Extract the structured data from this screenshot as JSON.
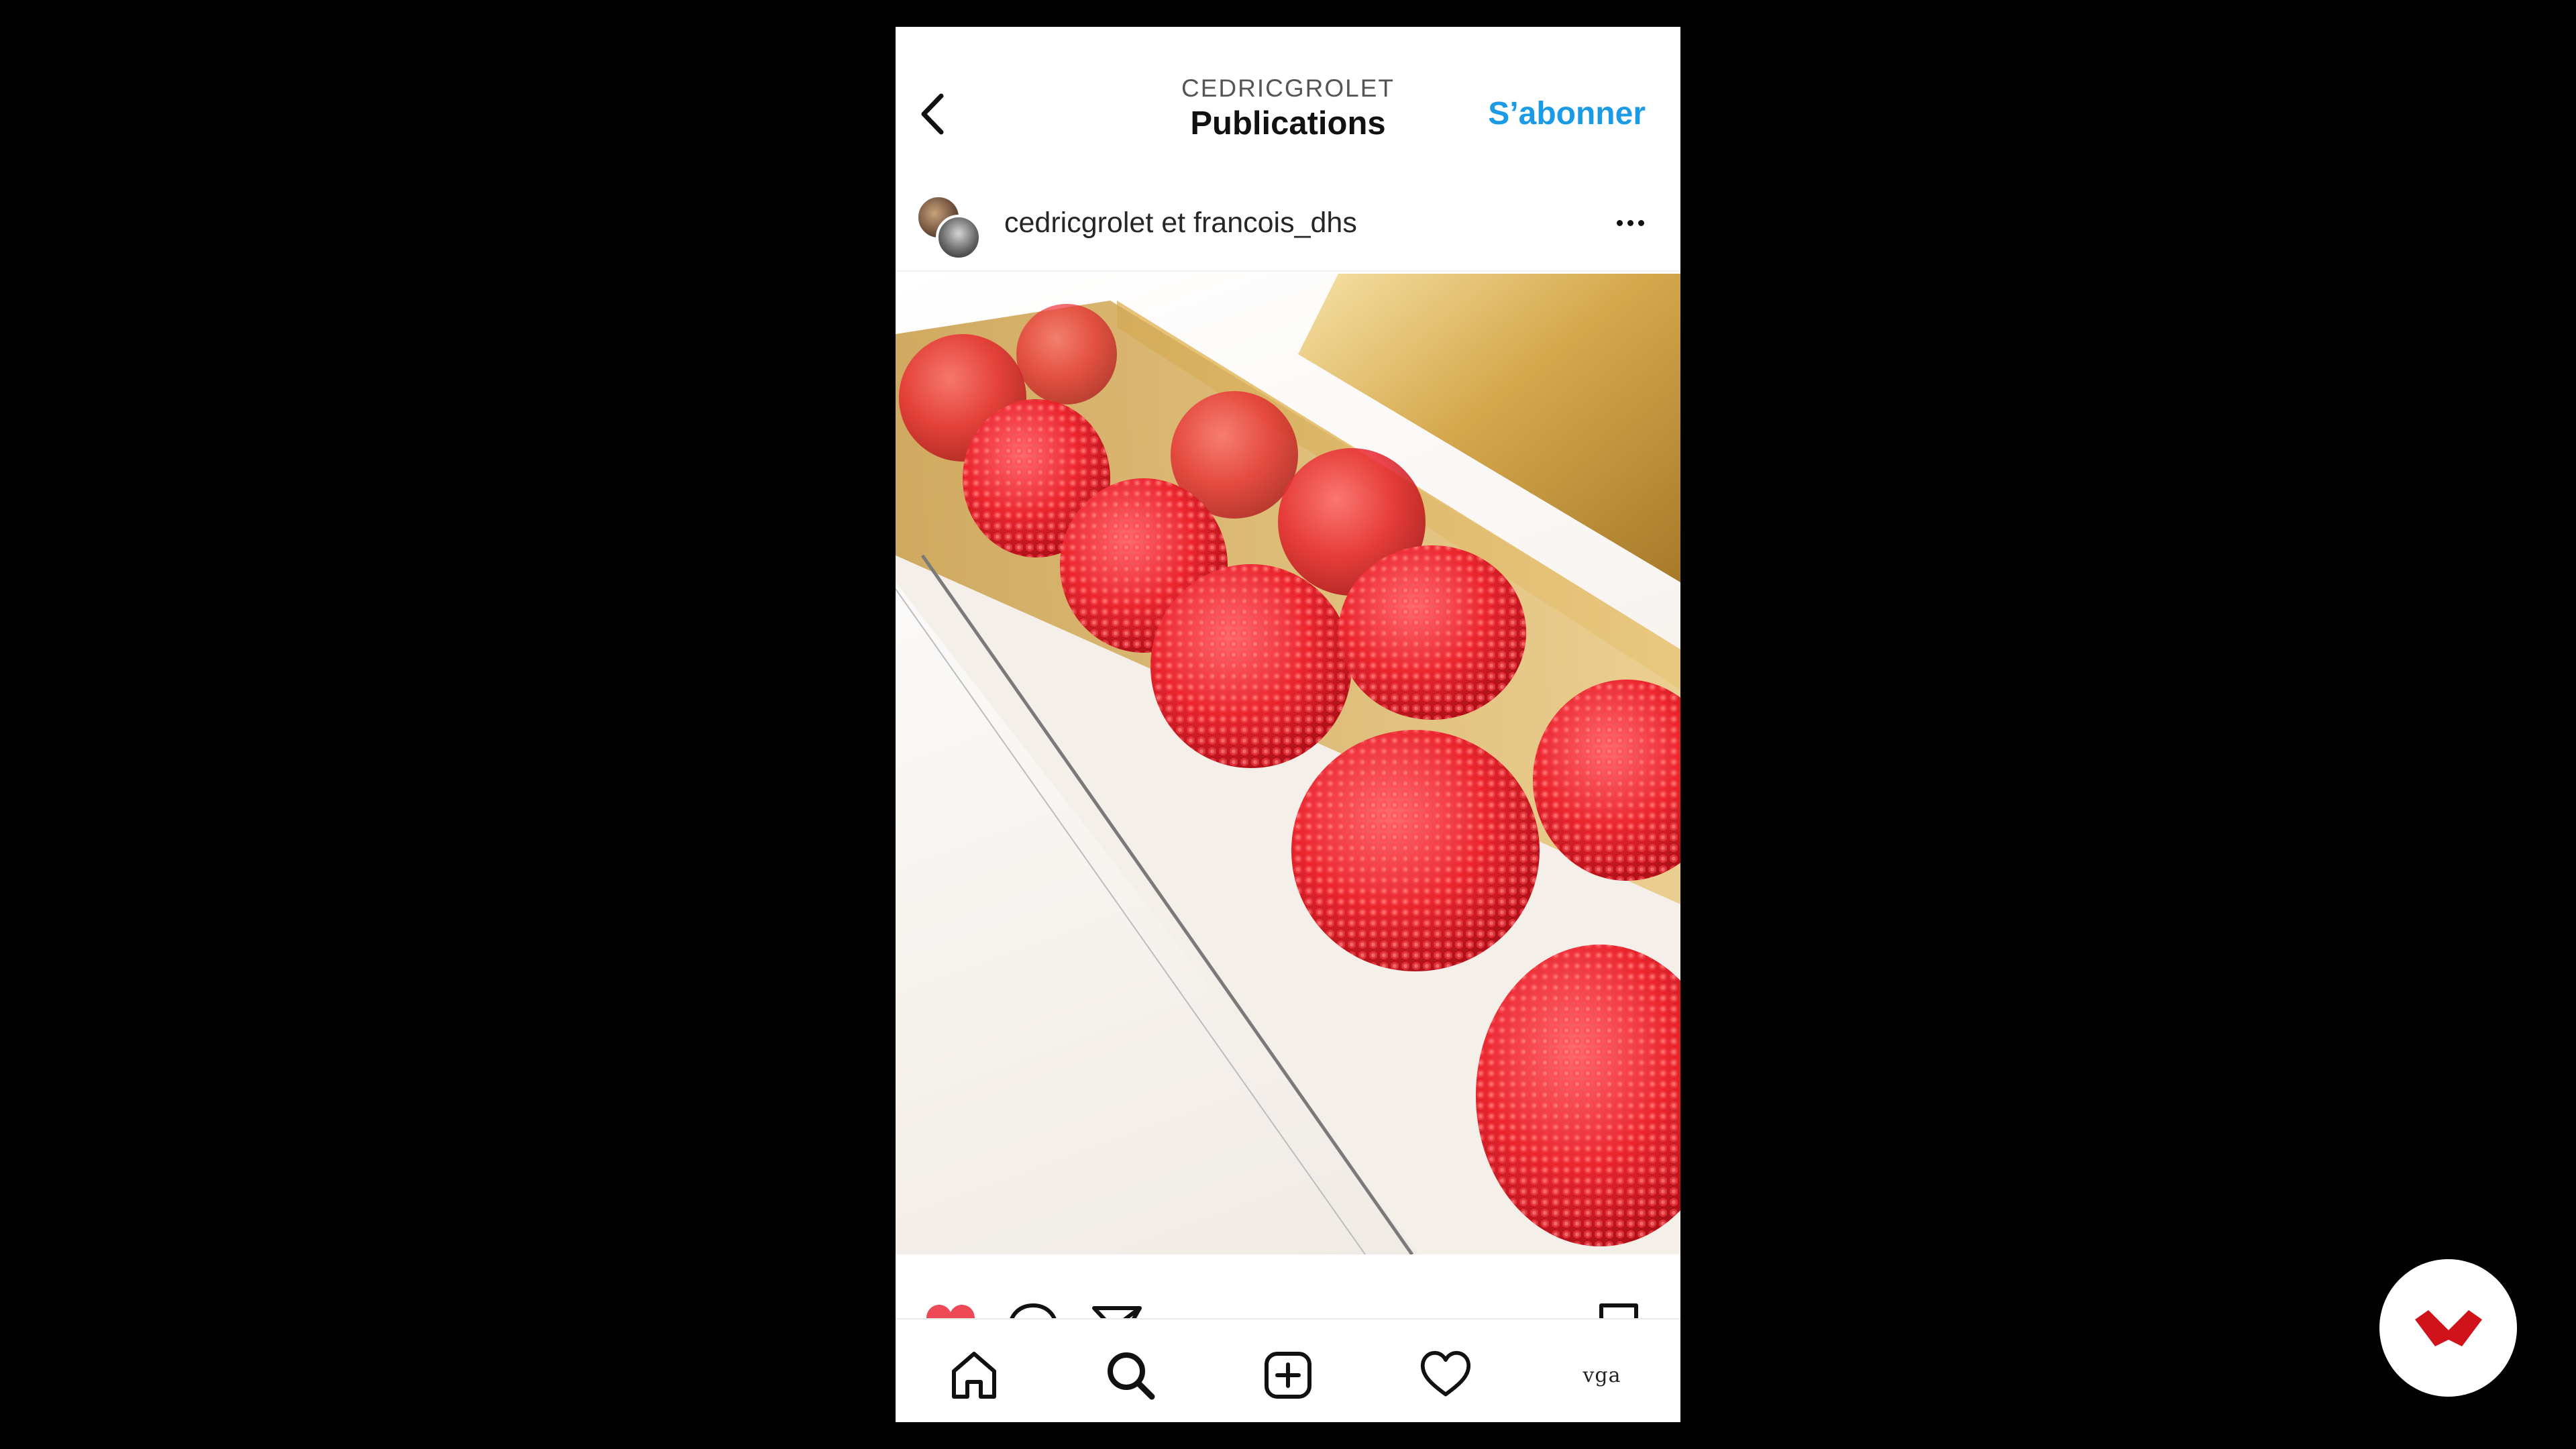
{
  "header": {
    "username": "CEDRICGROLET",
    "title": "Publications",
    "follow_label": "S’abonner"
  },
  "post": {
    "author_primary": "cedricgrolet",
    "author_joiner": " et ",
    "author_secondary": "francois_dhs",
    "liked": true
  },
  "tabbar": {
    "profile_label": "vga"
  },
  "colors": {
    "accent_blue": "#1b9ae6",
    "like_red": "#ed4956",
    "brand_red": "#d0121b"
  },
  "icons": {
    "back": "chevron-left-icon",
    "more": "more-dots-icon",
    "like": "heart-filled-icon",
    "comment": "comment-icon",
    "share": "send-icon",
    "save": "bookmark-icon",
    "home": "home-icon",
    "search": "search-icon",
    "add": "add-post-icon",
    "activity": "heart-outline-icon",
    "brand": "brand-logo-icon"
  }
}
